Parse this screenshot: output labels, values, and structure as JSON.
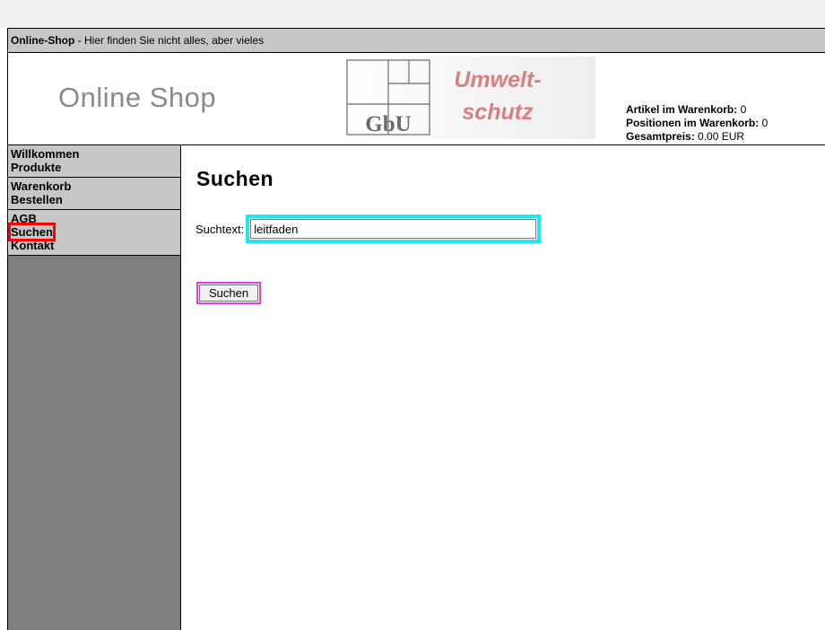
{
  "titlebar": {
    "brand": "Online-Shop",
    "tagline": " - Hier finden Sie nicht alles, aber vieles"
  },
  "header": {
    "shop_title": "Online Shop",
    "logo": {
      "mark_text": "GbU",
      "line1": "Umwelt-",
      "line2": "schutz"
    },
    "cart": {
      "items_label": "Artikel im Warenkorb:",
      "items_value": " 0",
      "positions_label": "Positionen im Warenkorb:",
      "positions_value": " 0",
      "total_label": "Gesamtpreis:",
      "total_value": " 0.00 EUR"
    }
  },
  "sidebar": {
    "groups": [
      {
        "items": [
          "Willkommen",
          "Produkte"
        ]
      },
      {
        "items": [
          "Warenkorb",
          "Bestellen"
        ]
      },
      {
        "items": [
          "AGB",
          "Suchen",
          "Kontakt"
        ]
      }
    ],
    "selected": "Suchen"
  },
  "main": {
    "title": "Suchen",
    "search": {
      "label": "Suchtext:",
      "value": "leitfaden",
      "placeholder": ""
    },
    "submit_label": "Suchen"
  },
  "colors": {
    "titlebar_bg": "#c7c7c7",
    "sidebar_bg": "#808080",
    "nav_bg": "#c7c7c7",
    "logo_text": "#d88080",
    "highlight_selected": "#ff0000",
    "highlight_input": "#22e6f0",
    "highlight_button": "#e040e0"
  }
}
